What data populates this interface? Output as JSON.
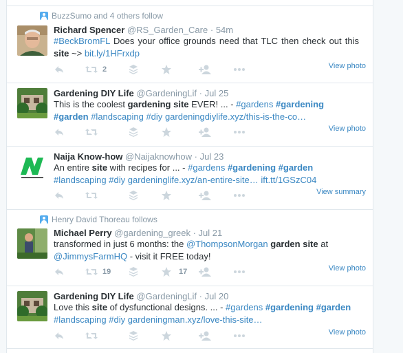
{
  "tweets": [
    {
      "context": "BuzzSumo and 4 others follow",
      "name": "Richard Spencer",
      "handle": "@RS_Garden_Care",
      "time": "54m",
      "view": "View photo",
      "retweets": "2",
      "likes": "",
      "segments": [
        {
          "t": "#BeckBromFL",
          "c": "tag"
        },
        {
          "t": " Does your office grounds need that TLC  then check out this ",
          "c": ""
        },
        {
          "t": "site",
          "c": "bold"
        },
        {
          "t": "  ~>  ",
          "c": ""
        },
        {
          "t": "bit.ly/1HFrxdp",
          "c": "link"
        }
      ]
    },
    {
      "context": "",
      "name": "Gardening DIY Life",
      "handle": "@GardeningLif",
      "time": "Jul 25",
      "view": "View photo",
      "retweets": "",
      "likes": "",
      "segments": [
        {
          "t": "This is the coolest ",
          "c": ""
        },
        {
          "t": "gardening site",
          "c": "bold"
        },
        {
          "t": " EVER! ... - ",
          "c": ""
        },
        {
          "t": "#gardens",
          "c": "tag"
        },
        {
          "t": " ",
          "c": ""
        },
        {
          "t": "#gardening",
          "c": "btag"
        },
        {
          "t": " ",
          "c": ""
        },
        {
          "t": "#garden",
          "c": "btag"
        },
        {
          "t": " ",
          "c": ""
        },
        {
          "t": "#landscaping",
          "c": "tag"
        },
        {
          "t": " ",
          "c": ""
        },
        {
          "t": "#diy",
          "c": "tag"
        },
        {
          "t": " ",
          "c": ""
        },
        {
          "t": "gardeningdiylife.xyz/this-is-the-co…",
          "c": "link"
        }
      ]
    },
    {
      "context": "",
      "name": "Naija Know-how",
      "handle": "@Naijaknowhow",
      "time": "Jul 23",
      "view": "View summary",
      "retweets": "",
      "likes": "",
      "segments": [
        {
          "t": "An entire ",
          "c": ""
        },
        {
          "t": "site",
          "c": "bold"
        },
        {
          "t": " with recipes for ... - ",
          "c": ""
        },
        {
          "t": "#gardens",
          "c": "tag"
        },
        {
          "t": " ",
          "c": ""
        },
        {
          "t": "#gardening",
          "c": "btag"
        },
        {
          "t": " ",
          "c": ""
        },
        {
          "t": "#garden",
          "c": "btag"
        },
        {
          "t": " ",
          "c": ""
        },
        {
          "t": "#landscaping",
          "c": "tag"
        },
        {
          "t": " ",
          "c": ""
        },
        {
          "t": "#diy",
          "c": "tag"
        },
        {
          "t": " ",
          "c": ""
        },
        {
          "t": "gardeninglife.xyz/an-entire-site…",
          "c": "link"
        },
        {
          "t": " ",
          "c": ""
        },
        {
          "t": "ift.tt/1GSzC04",
          "c": "link"
        }
      ]
    },
    {
      "context": "Henry David Thoreau follows",
      "name": "Michael Perry",
      "handle": "@gardening_greek",
      "time": "Jul 21",
      "view": "View photo",
      "retweets": "19",
      "likes": "17",
      "segments": [
        {
          "t": "transformed in just 6 months: the ",
          "c": ""
        },
        {
          "t": "@ThompsonMorgan",
          "c": "link"
        },
        {
          "t": " ",
          "c": ""
        },
        {
          "t": "garden site",
          "c": "bold"
        },
        {
          "t": " at ",
          "c": ""
        },
        {
          "t": "@JimmysFarmHQ",
          "c": "link"
        },
        {
          "t": " - visit it FREE today!",
          "c": ""
        }
      ]
    },
    {
      "context": "",
      "name": "Gardening DIY Life",
      "handle": "@GardeningLif",
      "time": "Jul 20",
      "view": "View photo",
      "retweets": "",
      "likes": "",
      "segments": [
        {
          "t": "Love this ",
          "c": ""
        },
        {
          "t": "site",
          "c": "bold"
        },
        {
          "t": " of dysfunctional designs. ... - ",
          "c": ""
        },
        {
          "t": "#gardens",
          "c": "tag"
        },
        {
          "t": " ",
          "c": ""
        },
        {
          "t": "#gardening",
          "c": "btag"
        },
        {
          "t": " ",
          "c": ""
        },
        {
          "t": "#garden",
          "c": "btag"
        },
        {
          "t": " ",
          "c": ""
        },
        {
          "t": "#landscaping",
          "c": "tag"
        },
        {
          "t": " ",
          "c": ""
        },
        {
          "t": "#diy",
          "c": "tag"
        },
        {
          "t": " ",
          "c": ""
        },
        {
          "t": "gardeningman.xyz/love-this-site…",
          "c": "link"
        }
      ]
    }
  ],
  "colors": {
    "link": "#3b88c3",
    "muted": "#8899a6",
    "icon": "#ccd6dd"
  },
  "icons": [
    "person-icon",
    "reply-icon",
    "retweet-icon",
    "stack-icon",
    "star-icon",
    "follow-icon",
    "more-icon"
  ]
}
